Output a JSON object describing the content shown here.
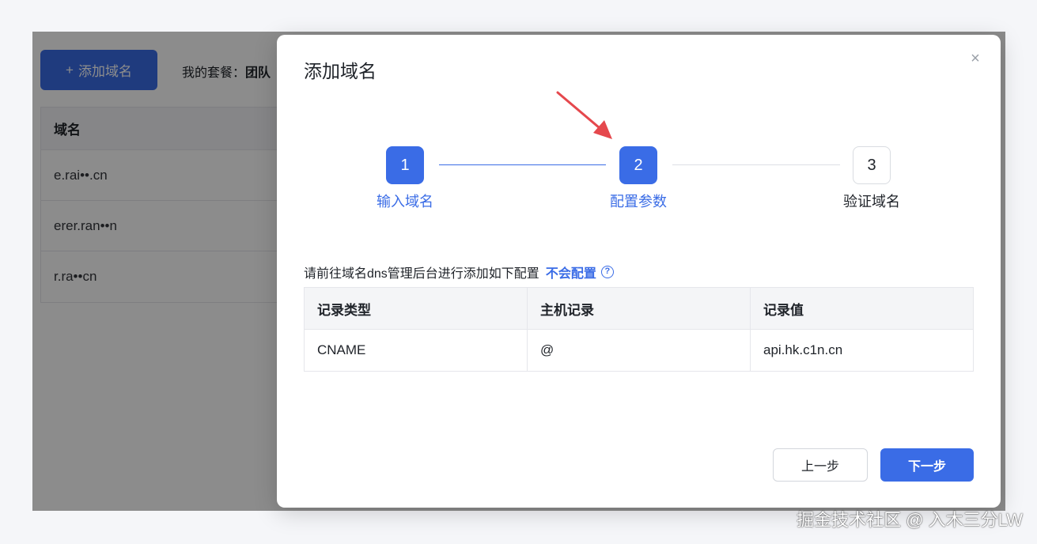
{
  "background": {
    "add_button_icon": "+",
    "add_button_label": "添加域名",
    "plan_prefix": "我的套餐：",
    "plan_name": "团队",
    "table_header": "域名",
    "domains": [
      "e.rai••.cn",
      "erer.ran••n",
      "r.ra••cn"
    ]
  },
  "modal": {
    "title": "添加域名",
    "close_icon": "×",
    "steps": [
      {
        "number": "1",
        "label": "输入域名",
        "state": "done"
      },
      {
        "number": "2",
        "label": "配置参数",
        "state": "active"
      },
      {
        "number": "3",
        "label": "验证域名",
        "state": "todo"
      }
    ],
    "hint_text": "请前往域名dns管理后台进行添加如下配置",
    "help_link": "不会配置",
    "help_icon": "?",
    "table": {
      "headers": [
        "记录类型",
        "主机记录",
        "记录值"
      ],
      "rows": [
        [
          "CNAME",
          "@",
          "api.hk.c1n.cn"
        ]
      ]
    },
    "prev_button": "上一步",
    "next_button": "下一步"
  },
  "watermark": "掘金技术社区 @ 入木三分LW",
  "colors": {
    "accent": "#3a6ce6",
    "arrow": "#e5484d"
  }
}
